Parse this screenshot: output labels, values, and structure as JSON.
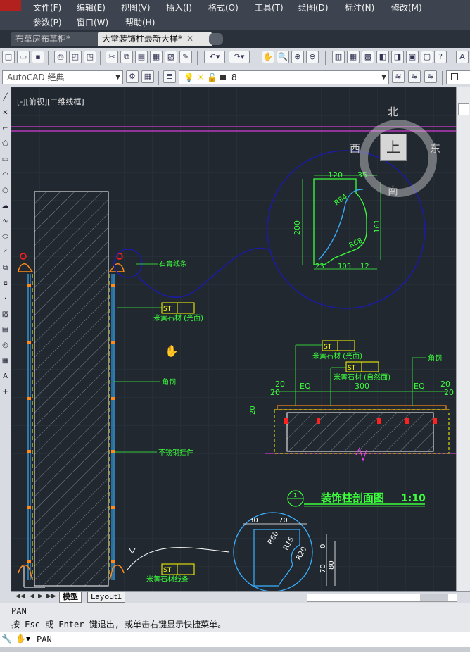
{
  "menubar": {
    "row1": [
      "文件(F)",
      "编辑(E)",
      "视图(V)",
      "插入(I)",
      "格式(O)",
      "工具(T)",
      "绘图(D)",
      "标注(N)",
      "修改(M)"
    ],
    "row2": [
      "参数(P)",
      "窗口(W)",
      "帮助(H)"
    ]
  },
  "tabs": [
    {
      "label": "布草房布草柜*",
      "active": false
    },
    {
      "label": "大堂装饰柱最新大样*",
      "active": true
    }
  ],
  "toolbar": {
    "workspace": "AutoCAD 经典",
    "layer": "8"
  },
  "viewport": {
    "label": "[-][俯视][二维线框]"
  },
  "viewcube": {
    "north": "北",
    "south": "南",
    "east": "东",
    "west": "西",
    "top": "上"
  },
  "drawing": {
    "labels": {
      "gypsum_molding": "石膏线条",
      "marble_polished": "米黄石材 (光面)",
      "angle_steel": "角钢",
      "ss_hanger": "不锈钢挂件",
      "marble_molding": "米黄石材线条",
      "marble_polished_2": "米黄石材 (光面)",
      "marble_natural": "米黄石材 (自然面)",
      "angle_steel_2": "角钢",
      "section_title": "装饰柱剖面图",
      "section_scale": "1:10",
      "section_num": "1",
      "tag": "ST"
    },
    "dims": {
      "d120": "120",
      "d35": "35",
      "d200": "200",
      "r84": "R84",
      "r68": "R68",
      "d161": "161",
      "d23": "23",
      "d105": "105",
      "d12": "12",
      "d20a": "20",
      "d20b": "20",
      "eq1": "EQ",
      "d300": "300",
      "eq2": "EQ",
      "d20c": "20",
      "d20d": "20",
      "d30": "30",
      "d70": "70",
      "r60": "R60",
      "r15": "R15",
      "r20": "R20",
      "d70b": "70",
      "d80": "80",
      "d20e": "20",
      "d0": "0"
    }
  },
  "layout_tabs": [
    {
      "label": "模型",
      "active": true
    },
    {
      "label": "Layout1",
      "active": false
    }
  ],
  "command": {
    "history1": "PAN",
    "history2": "按 Esc 或 Enter 键退出, 或单击右键显示快捷菜单。",
    "current": "PAN"
  },
  "colors": {
    "canvas": "#212830",
    "green": "#3cff3c",
    "yellow": "#ffff00",
    "blue": "#1b1ba8",
    "magenta": "#ff40ff",
    "white": "#ffffff",
    "red": "#ff2020"
  }
}
